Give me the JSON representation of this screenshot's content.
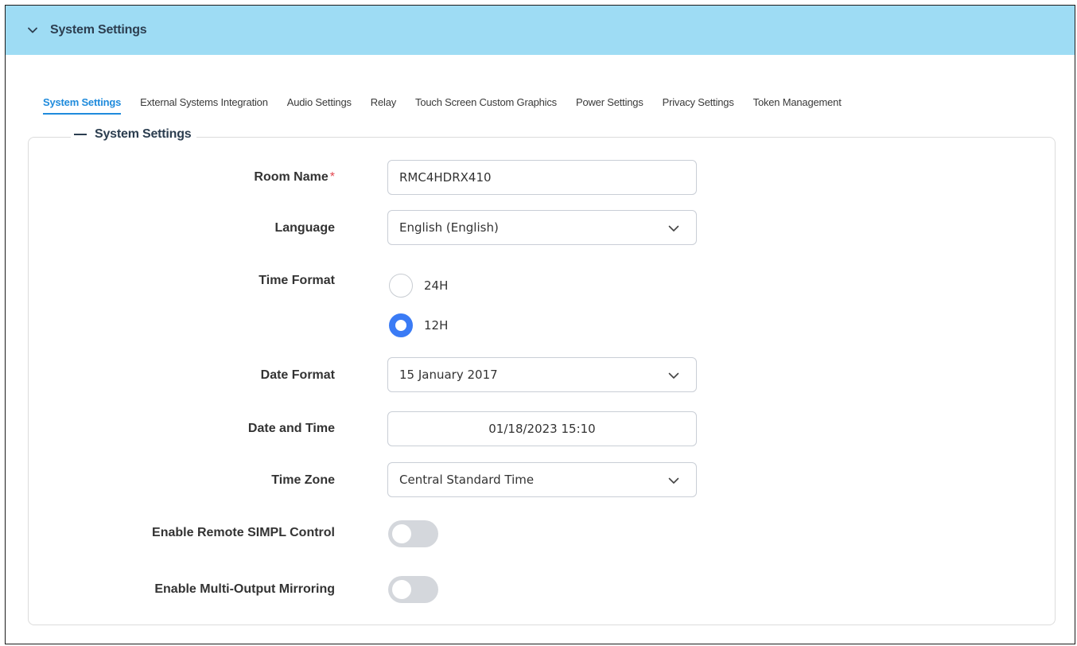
{
  "accordion": {
    "title": "System Settings"
  },
  "tabs": [
    {
      "label": "System Settings",
      "active": true
    },
    {
      "label": "External Systems Integration"
    },
    {
      "label": "Audio Settings"
    },
    {
      "label": "Relay"
    },
    {
      "label": "Touch Screen Custom Graphics"
    },
    {
      "label": "Power Settings"
    },
    {
      "label": "Privacy Settings"
    },
    {
      "label": "Token Management"
    }
  ],
  "section": {
    "legend": "System Settings"
  },
  "form": {
    "room_name": {
      "label": "Room Name",
      "required_mark": "*",
      "value": "RMC4HDRX410"
    },
    "language": {
      "label": "Language",
      "value": "English (English)"
    },
    "time_format": {
      "label": "Time Format",
      "options": [
        "24H",
        "12H"
      ],
      "selected": "12H"
    },
    "date_format": {
      "label": "Date Format",
      "value": "15 January 2017"
    },
    "date_time": {
      "label": "Date and Time",
      "value": "01/18/2023 15:10"
    },
    "time_zone": {
      "label": "Time Zone",
      "value": "Central Standard Time"
    },
    "remote_simpl": {
      "label": "Enable Remote SIMPL Control",
      "enabled": false
    },
    "multi_output": {
      "label": "Enable Multi-Output Mirroring",
      "enabled": false
    }
  },
  "colors": {
    "header_bg": "#9edcf4",
    "active_tab": "#1f8bdc",
    "radio_checked": "#3a7bf5",
    "toggle_off": "#d4d7dc",
    "required": "#e34850"
  },
  "icons": {
    "header": "chevron-down-icon",
    "select": "chevron-down-icon"
  }
}
